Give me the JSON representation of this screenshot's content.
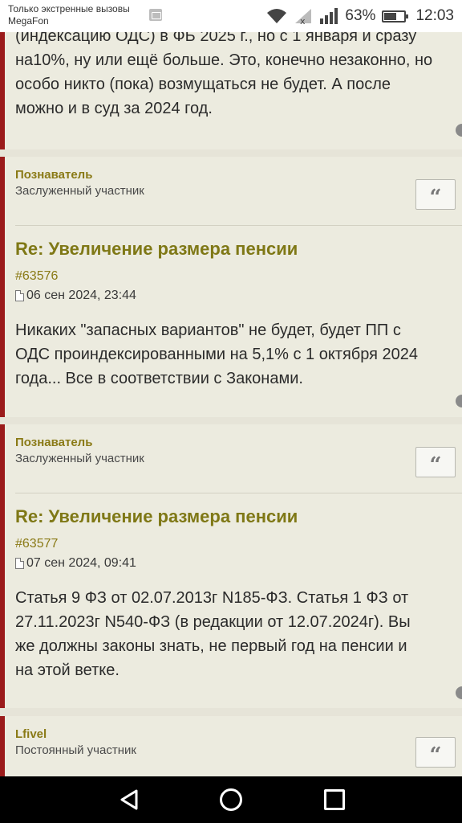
{
  "status_bar": {
    "emergency_text": "Только экстренные вызовы",
    "carrier": "MegaFon",
    "battery_percent": "63%",
    "battery_level": 0.63,
    "time": "12:03",
    "icons": [
      "image-icon",
      "wifi-icon",
      "signal-no-sim-icon",
      "signal-icon",
      "battery-icon"
    ]
  },
  "posts": [
    {
      "body_lines": [
        "(индексацию ОДС) в ФБ 2025 г., но с 1 января и сразу",
        "на10%, ну или ещё больше. Это, конечно незаконно, но",
        "особо никто (пока) возмущаться не будет. А после",
        "можно и в суд за 2024 год."
      ]
    },
    {
      "author": "Познаватель",
      "rank": "Заслуженный участник",
      "quote_label": "“",
      "title": "Re: Увеличение размера пенсии",
      "post_id": "#63576",
      "date": "06 сен 2024, 23:44",
      "body_lines": [
        "Никаких \"запасных вариантов\" не будет, будет ПП с",
        "ОДС проиндексированными на 5,1% с 1 октября 2024",
        "года... Все в соответствии с Законами."
      ]
    },
    {
      "author": "Познаватель",
      "rank": "Заслуженный участник",
      "quote_label": "“",
      "title": "Re: Увеличение размера пенсии",
      "post_id": "#63577",
      "date": "07 сен 2024, 09:41",
      "body_lines": [
        "Статья 9 ФЗ от 02.07.2013г N185-ФЗ. Статья 1 ФЗ от",
        "27.11.2023г N540-ФЗ (в редакции от 12.07.2024г). Вы",
        "же должны законы знать, не первый год на пенсии и",
        "на этой ветке."
      ]
    },
    {
      "author": "Lfivel",
      "rank": "Постоянный участник",
      "quote_label": "“"
    }
  ],
  "nav": {
    "icons": [
      "back-icon",
      "home-icon",
      "recent-apps-icon"
    ]
  },
  "colors": {
    "accent_border": "#9b1b1b",
    "author": "#8a7a16",
    "title": "#7f7816",
    "post_bg": "#ecebdf",
    "page_bg": "#e6e4d8"
  }
}
